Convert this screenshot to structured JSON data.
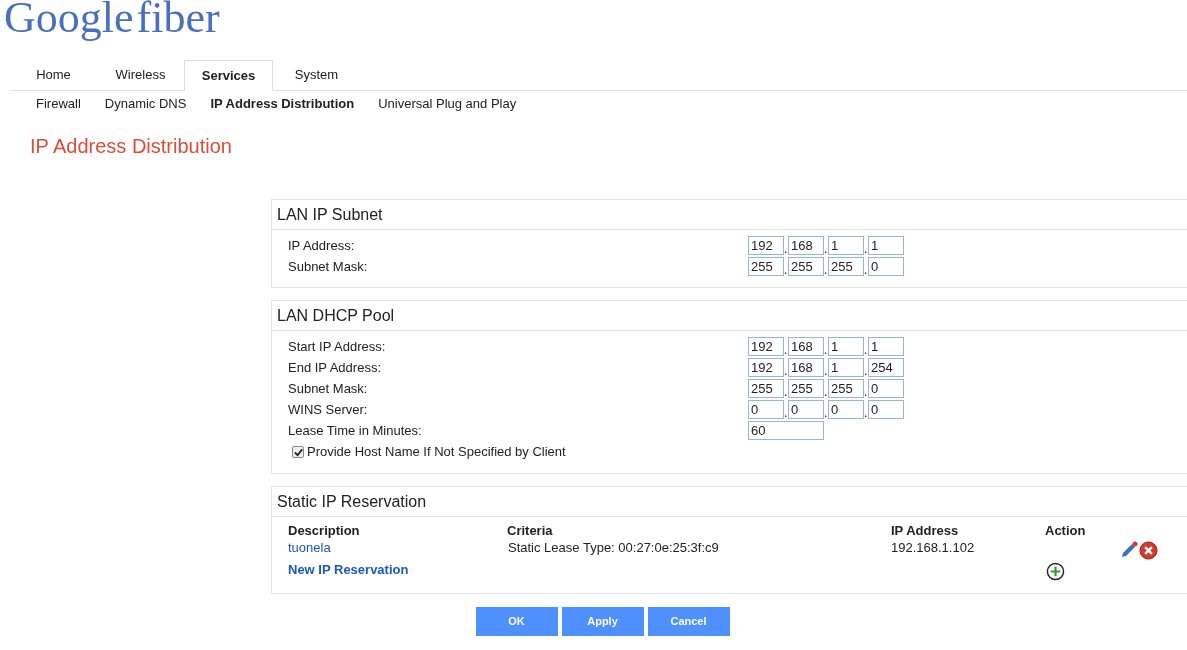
{
  "logo": {
    "word1": "Google",
    "word2": "fiber"
  },
  "tabs": [
    {
      "label": "Home",
      "selected": false
    },
    {
      "label": "Wireless",
      "selected": false
    },
    {
      "label": "Services",
      "selected": true
    },
    {
      "label": "System",
      "selected": false
    }
  ],
  "subtabs": [
    {
      "label": "Firewall",
      "selected": false
    },
    {
      "label": "Dynamic DNS",
      "selected": false
    },
    {
      "label": "IP Address Distribution",
      "selected": true
    },
    {
      "label": "Universal Plug and Play",
      "selected": false
    }
  ],
  "page_title": "IP Address Distribution",
  "octet_separator": ".",
  "sections": [
    {
      "title": "LAN IP Subnet",
      "rows": [
        {
          "kind": "ip",
          "label": "IP Address:",
          "octets": [
            "192",
            "168",
            "1",
            "1"
          ]
        },
        {
          "kind": "ip",
          "label": "Subnet Mask:",
          "octets": [
            "255",
            "255",
            "255",
            "0"
          ]
        }
      ]
    },
    {
      "title": "LAN DHCP Pool",
      "rows": [
        {
          "kind": "ip",
          "label": "Start IP Address:",
          "octets": [
            "192",
            "168",
            "1",
            "1"
          ]
        },
        {
          "kind": "ip",
          "label": "End IP Address:",
          "octets": [
            "192",
            "168",
            "1",
            "254"
          ]
        },
        {
          "kind": "ip",
          "label": "Subnet Mask:",
          "octets": [
            "255",
            "255",
            "255",
            "0"
          ]
        },
        {
          "kind": "ip",
          "label": "WINS Server:",
          "octets": [
            "0",
            "0",
            "0",
            "0"
          ]
        },
        {
          "kind": "text",
          "label": "Lease Time in Minutes:",
          "value": "60"
        },
        {
          "kind": "checkbox",
          "label": "Provide Host Name If Not Specified by Client",
          "checked": true
        }
      ]
    }
  ],
  "reservation": {
    "title": "Static IP Reservation",
    "columns": [
      "Description",
      "Criteria",
      "IP Address",
      "Action"
    ],
    "rows": [
      {
        "description": "tuonela",
        "criteria": "Static Lease Type: 00:27:0e:25:3f:c9",
        "ip": "192.168.1.102"
      }
    ],
    "new_link": "New IP Reservation"
  },
  "buttons": [
    "OK",
    "Apply",
    "Cancel"
  ]
}
